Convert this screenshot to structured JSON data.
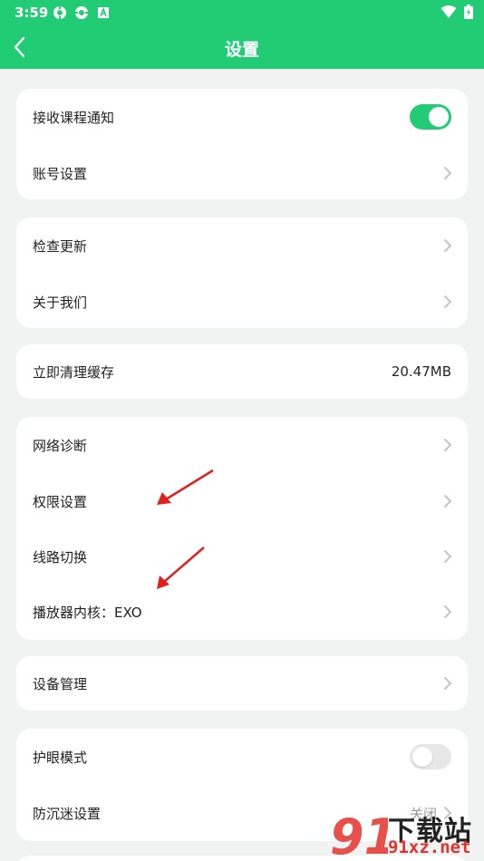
{
  "status_bar": {
    "time": "3:59",
    "left_icons": [
      "settings-app-icon",
      "settings-app-icon",
      "a-icon"
    ],
    "right_icons": [
      "wifi-icon",
      "battery-icon"
    ]
  },
  "header": {
    "title": "设置",
    "back_icon": "chevron-left-icon",
    "color": "#22cc74"
  },
  "groups": [
    {
      "rows": [
        {
          "label": "接收课程通知",
          "control": "toggle",
          "state": "on"
        },
        {
          "label": "账号设置",
          "control": "chevron"
        }
      ]
    },
    {
      "rows": [
        {
          "label": "检查更新",
          "control": "chevron"
        },
        {
          "label": "关于我们",
          "control": "chevron"
        }
      ]
    },
    {
      "rows": [
        {
          "label": "立即清理缓存",
          "control": "value",
          "value": "20.47MB"
        }
      ]
    },
    {
      "rows": [
        {
          "label": "网络诊断",
          "control": "chevron"
        },
        {
          "label": "权限设置",
          "control": "chevron"
        },
        {
          "label": "线路切换",
          "control": "chevron"
        },
        {
          "label": "播放器内核：EXO",
          "control": "chevron"
        }
      ]
    },
    {
      "rows": [
        {
          "label": "设备管理",
          "control": "chevron"
        }
      ]
    },
    {
      "rows": [
        {
          "label": "护眼模式",
          "control": "toggle",
          "state": "off"
        },
        {
          "label": "防沉迷设置",
          "control": "value",
          "value": "关闭"
        }
      ]
    }
  ],
  "annotations": {
    "arrow_color": "#e02020"
  },
  "watermark": {
    "logo_text": "91",
    "text": "下载站",
    "url": "91xz.net"
  }
}
